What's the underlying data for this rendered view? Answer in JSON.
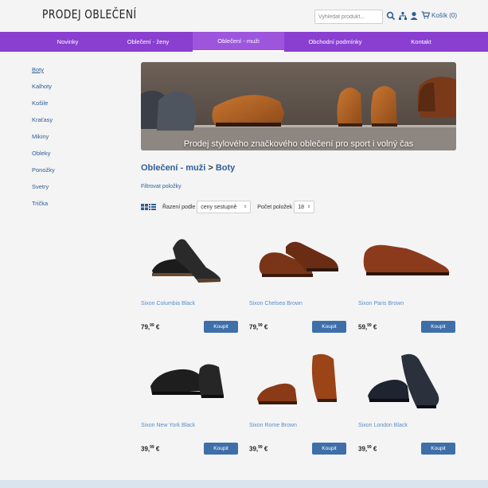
{
  "header": {
    "logo": "PRODEJ OBLEČENÍ",
    "search_placeholder": "Vyhledat produkt...",
    "cart_label": "Košík (0)"
  },
  "nav": {
    "items": [
      {
        "label": "Novinky"
      },
      {
        "label": "Oblečení - ženy"
      },
      {
        "label": "Oblečení - muži",
        "active": true
      },
      {
        "label": "Obchodní podmínky"
      },
      {
        "label": "Kontakt"
      }
    ]
  },
  "sidebar": {
    "items": [
      "Boty",
      "Kalhoty",
      "Košile",
      "Kraťasy",
      "Mikiny",
      "Obleky",
      "Ponožky",
      "Svetry",
      "Trička"
    ]
  },
  "banner": {
    "caption": "Prodej stylového značkového oblečení pro sport i volný čas"
  },
  "breadcrumb": {
    "parent": "Oblečení - muži",
    "separator": ">",
    "current": "Boty"
  },
  "filter_label": "Filtrovat položky",
  "toolbar": {
    "sort_label": "Řazení podle",
    "sort_value": "ceny sestupně",
    "count_label": "Počet položek",
    "count_value": "18"
  },
  "products": [
    {
      "name": "Sixon Columbia Black",
      "price_main": "79,",
      "price_cents": "99",
      "currency": "€",
      "buy": "Koupit"
    },
    {
      "name": "Sixon Chelsea Brown",
      "price_main": "79,",
      "price_cents": "99",
      "currency": "€",
      "buy": "Koupit"
    },
    {
      "name": "Sixon Paris Brown",
      "price_main": "59,",
      "price_cents": "99",
      "currency": "€",
      "buy": "Koupit"
    },
    {
      "name": "Sixon New York Black",
      "price_main": "39,",
      "price_cents": "99",
      "currency": "€",
      "buy": "Koupit"
    },
    {
      "name": "Sixon Rome Brown",
      "price_main": "39,",
      "price_cents": "99",
      "currency": "€",
      "buy": "Koupit"
    },
    {
      "name": "Sixon London Black",
      "price_main": "39,",
      "price_cents": "99",
      "currency": "€",
      "buy": "Koupit"
    }
  ],
  "colors": {
    "nav_bg": "#8a3fd1",
    "link": "#2f5f95",
    "button": "#3f6fa9"
  }
}
